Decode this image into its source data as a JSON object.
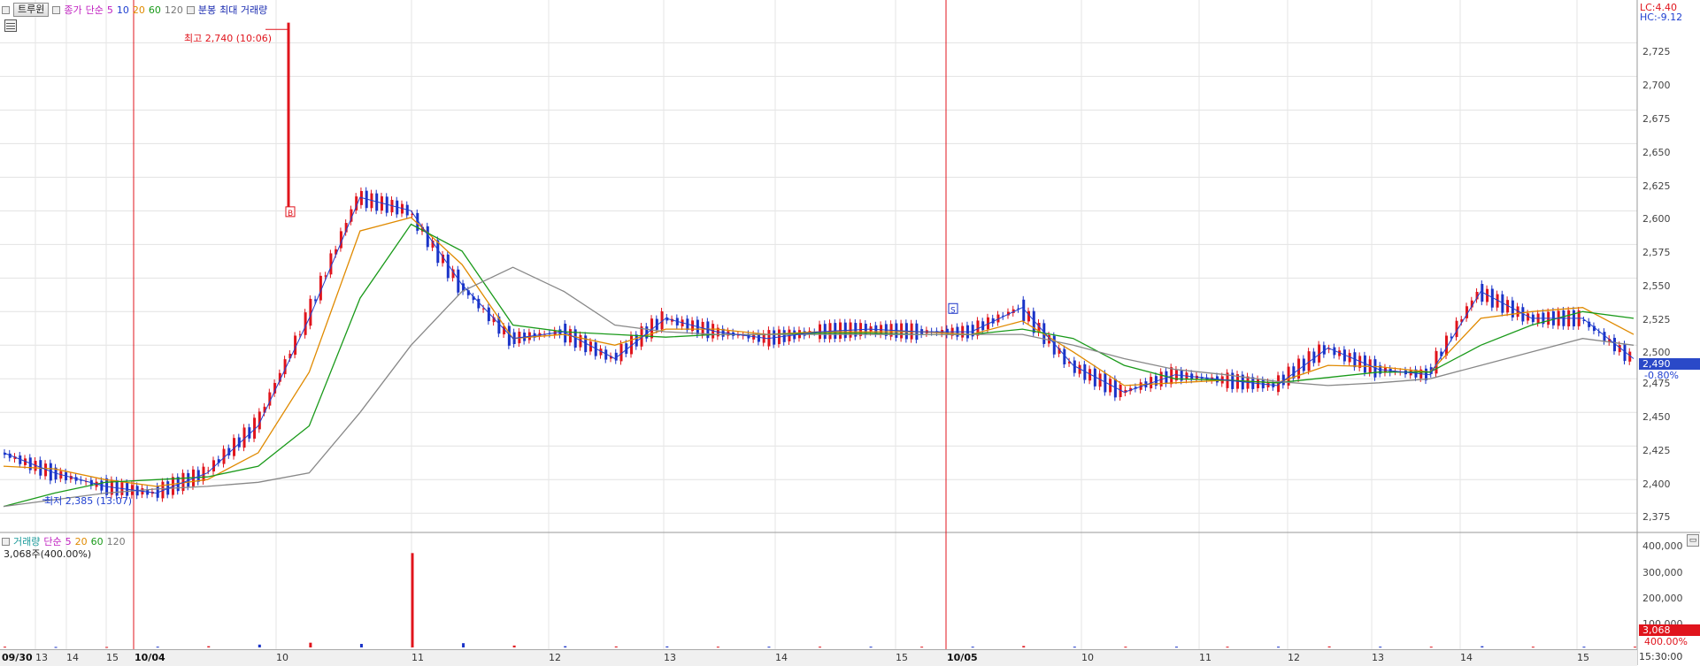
{
  "legend": {
    "tab": "트루윈",
    "close_price": "종가",
    "simple": "단순",
    "ma": [
      "5",
      "10",
      "20",
      "60",
      "120"
    ],
    "interval": "분봉",
    "max_volume": "최대 거래량"
  },
  "readout": {
    "lc": "LC:4.40",
    "hc": "HC:-9.12"
  },
  "annotations": {
    "high": "최고 2,740 (10:06)",
    "low": "최저 2,385 (13:07)",
    "buy_marker": "B",
    "sell_marker": "S"
  },
  "price_axis": [
    "2,725",
    "2,700",
    "2,675",
    "2,650",
    "2,625",
    "2,600",
    "2,575",
    "2,550",
    "2,525",
    "2,500",
    "2,475",
    "2,450",
    "2,425",
    "2,400",
    "2,375"
  ],
  "current_price": "2,490",
  "change_pct": "-0.80%",
  "volume_legend": {
    "title": "거래량",
    "simple": "단순",
    "ma": [
      "5",
      "20",
      "60",
      "120"
    ]
  },
  "volume_sub": "3,068주(400.00%)",
  "volume_axis": [
    "400,000",
    "300,000",
    "200,000",
    "100,000"
  ],
  "current_volume": "3,068",
  "volume_pct": "400.00%",
  "x_axis": [
    "09/30",
    "13",
    "14",
    "15",
    "10/04",
    "10",
    "11",
    "12",
    "13",
    "14",
    "15",
    "10/05",
    "10",
    "11",
    "12",
    "13",
    "14",
    "15"
  ],
  "time": "15:30:00",
  "colors": {
    "up": "#e0141c",
    "down": "#1a33c8",
    "ma5": "#c020c0",
    "ma10": "#2040d0",
    "ma20": "#e08a00",
    "ma60": "#1a9a1a",
    "ma120": "#888888"
  },
  "chart_data": {
    "type": "line",
    "title": "트루윈 분봉",
    "ylim": [
      2362,
      2745
    ],
    "high": {
      "value": 2740,
      "time": "10:06"
    },
    "low": {
      "value": 2385,
      "time": "13:07"
    },
    "x": [
      "09/30 12:30",
      "09/30 13:00",
      "09/30 13:30",
      "09/30 14:00",
      "09/30 14:30",
      "09/30 15:00",
      "09/30 15:30",
      "10/04 09:30",
      "10/04 10:00",
      "10/04 10:30",
      "10/04 11:00",
      "10/04 11:30",
      "10/04 12:00",
      "10/04 12:30",
      "10/04 13:00",
      "10/04 13:30",
      "10/04 14:00",
      "10/04 14:30",
      "10/04 15:00",
      "10/04 15:30",
      "10/05 09:30",
      "10/05 10:00",
      "10/05 10:30",
      "10/05 11:00",
      "10/05 11:30",
      "10/05 12:00",
      "10/05 12:30",
      "10/05 13:00",
      "10/05 13:30",
      "10/05 14:00",
      "10/05 14:30",
      "10/05 15:00",
      "10/05 15:30"
    ],
    "series": [
      {
        "name": "종가",
        "values": [
          2420,
          2405,
          2395,
          2390,
          2405,
          2440,
          2520,
          2610,
          2600,
          2545,
          2505,
          2510,
          2490,
          2520,
          2510,
          2505,
          2510,
          2512,
          2510,
          2510,
          2528,
          2485,
          2465,
          2478,
          2474,
          2470,
          2498,
          2482,
          2478,
          2540,
          2520,
          2520,
          2490
        ]
      },
      {
        "name": "20",
        "values": [
          2410,
          2408,
          2400,
          2395,
          2400,
          2420,
          2480,
          2585,
          2595,
          2560,
          2505,
          2508,
          2500,
          2512,
          2512,
          2508,
          2510,
          2510,
          2510,
          2508,
          2518,
          2495,
          2470,
          2472,
          2474,
          2472,
          2485,
          2484,
          2480,
          2520,
          2525,
          2528,
          2508
        ]
      },
      {
        "name": "60",
        "values": [
          2380,
          2390,
          2398,
          2400,
          2402,
          2410,
          2440,
          2535,
          2590,
          2570,
          2515,
          2510,
          2508,
          2506,
          2508,
          2508,
          2509,
          2509,
          2508,
          2508,
          2512,
          2505,
          2485,
          2475,
          2474,
          2472,
          2476,
          2480,
          2480,
          2500,
          2515,
          2525,
          2520
        ]
      },
      {
        "name": "120",
        "values": [
          2380,
          2385,
          2390,
          2393,
          2395,
          2398,
          2405,
          2450,
          2500,
          2540,
          2558,
          2540,
          2515,
          2510,
          2508,
          2508,
          2508,
          2508,
          2508,
          2508,
          2508,
          2500,
          2490,
          2482,
          2478,
          2473,
          2470,
          2472,
          2475,
          2485,
          2495,
          2505,
          2500
        ]
      }
    ],
    "volume": {
      "ylim": [
        0,
        420000
      ],
      "values": [
        3000,
        2000,
        2000,
        3000,
        5000,
        12000,
        20000,
        15000,
        400000,
        18000,
        8000,
        5000,
        4000,
        4000,
        3000,
        3000,
        3000,
        3000,
        3000,
        3000,
        6000,
        3000,
        3000,
        3000,
        3000,
        3000,
        4000,
        3000,
        3000,
        5000,
        3000,
        3000,
        3068
      ]
    }
  }
}
